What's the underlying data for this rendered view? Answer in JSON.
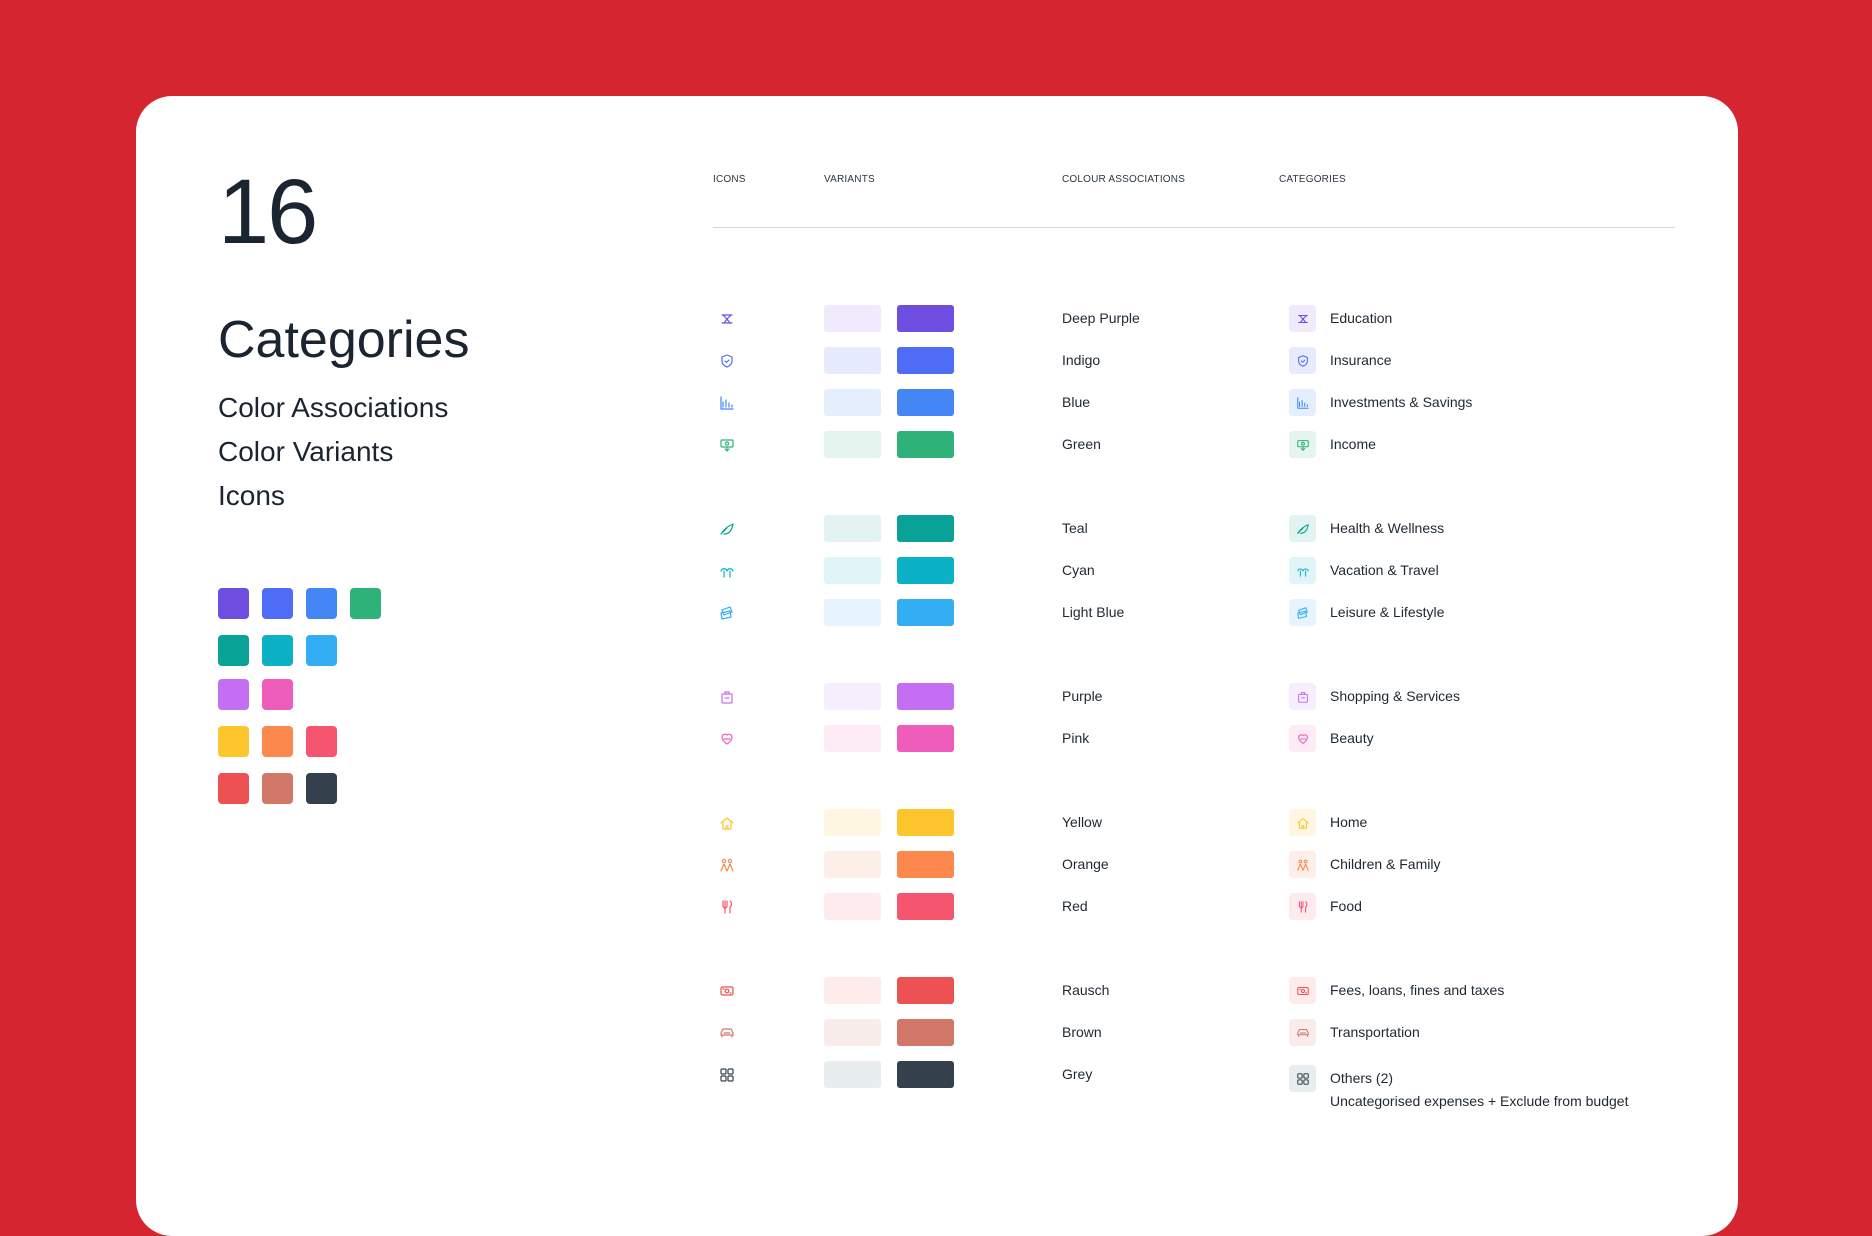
{
  "header": {
    "count": "16",
    "title": "Categories",
    "subtitles": [
      "Color Associations",
      "Color Variants",
      "Icons"
    ]
  },
  "palette_rows": [
    [
      "#6e4ee0",
      "#4f6cf7",
      "#4586f6",
      "#2fb27a"
    ],
    [
      "#08a296",
      "#0ab1c7",
      "#33aef5"
    ],
    [
      "#c46ef3",
      "#ee5dba"
    ],
    [
      "#fcc62c",
      "#fd884e",
      "#f65570"
    ],
    [
      "#ee5151",
      "#d27869",
      "#34414c"
    ]
  ],
  "table": {
    "columns": [
      "ICONS",
      "VARIANTS",
      "COLOUR ASSOCIATIONS",
      "CATEGORIES"
    ],
    "rows": [
      {
        "icon": "graduation-icon",
        "light": "#efebfc",
        "dark": "#6e4ee0",
        "color_name": "Deep Purple",
        "category": "Education"
      },
      {
        "icon": "shield-icon",
        "light": "#e6ebfd",
        "dark": "#4f6cf7",
        "color_name": "Indigo",
        "category": "Insurance"
      },
      {
        "icon": "chart-icon",
        "light": "#e4eefd",
        "dark": "#4586f6",
        "color_name": "Blue",
        "category": "Investments & Savings"
      },
      {
        "icon": "money-icon",
        "light": "#e3f5ee",
        "dark": "#2fb27a",
        "color_name": "Green",
        "category": "Income"
      },
      {
        "icon": "leaf-icon",
        "light": "#e2f3f1",
        "dark": "#08a296",
        "color_name": "Teal",
        "category": "Health & Wellness"
      },
      {
        "icon": "palm-icon",
        "light": "#e0f5f8",
        "dark": "#0ab1c7",
        "color_name": "Cyan",
        "category": "Vacation & Travel"
      },
      {
        "icon": "ticket-icon",
        "light": "#e5f4fd",
        "dark": "#33aef5",
        "color_name": "Light Blue",
        "category": "Leisure & Lifestyle"
      },
      {
        "icon": "bag-icon",
        "light": "#f7eefd",
        "dark": "#c46ef3",
        "color_name": "Purple",
        "category": "Shopping & Services"
      },
      {
        "icon": "heart-icon",
        "light": "#fdebf6",
        "dark": "#ee5dba",
        "color_name": "Pink",
        "category": "Beauty"
      },
      {
        "icon": "home-icon",
        "light": "#fff7e2",
        "dark": "#fcc62c",
        "color_name": "Yellow",
        "category": "Home"
      },
      {
        "icon": "family-icon",
        "light": "#fdeee7",
        "dark": "#fd884e",
        "color_name": "Orange",
        "category": "Children & Family"
      },
      {
        "icon": "utensils-icon",
        "light": "#feebee",
        "dark": "#f65570",
        "color_name": "Red",
        "category": "Food"
      },
      {
        "icon": "cash-icon",
        "light": "#fdeceb",
        "dark": "#ee5151",
        "color_name": "Rausch",
        "category": "Fees, loans, fines and taxes"
      },
      {
        "icon": "car-icon",
        "light": "#f8edeb",
        "dark": "#d27869",
        "color_name": "Brown",
        "category": "Transportation"
      },
      {
        "icon": "grid-icon",
        "light": "#e8edf0",
        "dark": "#34414c",
        "color_name": "Grey",
        "category": "Others (2)",
        "category_sub": "Uncategorised expenses + Exclude from budget"
      }
    ]
  }
}
